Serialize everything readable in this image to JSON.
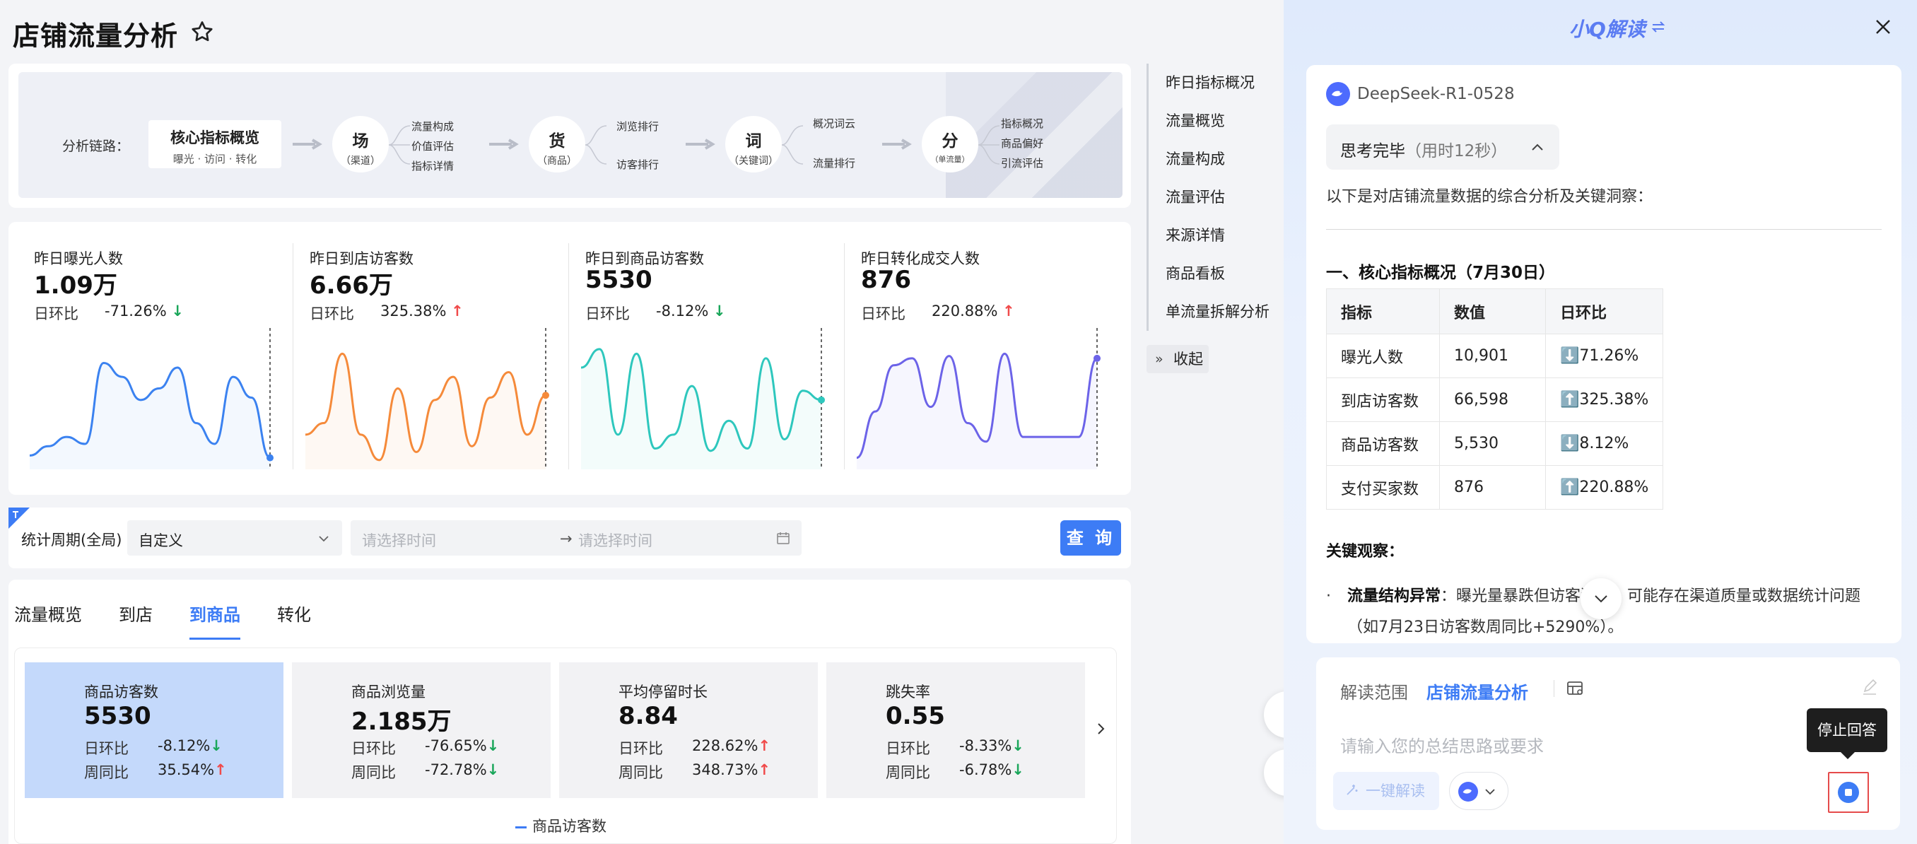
{
  "header": {
    "title": "店铺流量分析",
    "star_icon": "star-icon"
  },
  "chain": {
    "label": "分析链路：",
    "core": {
      "title": "核心指标概览",
      "sub": "曝光 · 访问 · 转化"
    },
    "nodes": [
      {
        "char": "场",
        "sub": "（渠道）",
        "items": [
          "流量构成",
          "价值评估",
          "指标详情"
        ]
      },
      {
        "char": "货",
        "sub": "（商品）",
        "items": [
          "浏览排行",
          "访客排行"
        ]
      },
      {
        "char": "词",
        "sub": "（关键词）",
        "items": [
          "概况词云",
          "流量排行"
        ]
      },
      {
        "char": "分",
        "sub": "（单流量）",
        "items": [
          "指标概况",
          "商品偏好",
          "引流评估"
        ]
      }
    ]
  },
  "kpis": [
    {
      "label": "昨日曝光人数",
      "value": "1.09万",
      "cmp_label": "日环比",
      "cmp_value": "-71.26%",
      "trend": "down",
      "color": "#3b82f0",
      "series": [
        12,
        20,
        28,
        22,
        92,
        80,
        60,
        70,
        88,
        40,
        22,
        80,
        62,
        10
      ]
    },
    {
      "label": "昨日到店访客数",
      "value": "6.66万",
      "cmp_label": "日环比",
      "cmp_value": "325.38%",
      "trend": "up",
      "color": "#f58a3a",
      "series": [
        30,
        40,
        100,
        30,
        8,
        70,
        15,
        60,
        80,
        20,
        62,
        84,
        30,
        64
      ]
    },
    {
      "label": "昨日到商品访客数",
      "value": "5530",
      "cmp_label": "日环比",
      "cmp_value": "-8.12%",
      "trend": "down",
      "color": "#2ec7bd",
      "series": [
        88,
        104,
        30,
        100,
        18,
        30,
        72,
        16,
        42,
        18,
        96,
        26,
        68,
        60
      ]
    },
    {
      "label": "昨日转化成交人数",
      "value": "876",
      "cmp_label": "日环比",
      "cmp_value": "220.88%",
      "trend": "up",
      "color": "#6c63e8",
      "series": [
        10,
        50,
        90,
        96,
        54,
        98,
        40,
        24,
        100,
        28,
        28,
        28,
        28,
        96
      ]
    }
  ],
  "filter": {
    "label": "统计周期(全局)",
    "select_value": "自定义",
    "start_placeholder": "请选择时间",
    "end_placeholder": "请选择时间",
    "arrow": "→",
    "query": "查 询"
  },
  "tabs": [
    "流量概览",
    "到店",
    "到商品",
    "转化"
  ],
  "metrics": [
    {
      "label": "商品访客数",
      "value": "5530",
      "r1l": "日环比",
      "r1v": "-8.12%",
      "r1t": "down",
      "r2l": "周同比",
      "r2v": "35.54%",
      "r2t": "up"
    },
    {
      "label": "商品浏览量",
      "value": "2.185万",
      "r1l": "日环比",
      "r1v": "-76.65%",
      "r1t": "down",
      "r2l": "周同比",
      "r2v": "-72.78%",
      "r2t": "down"
    },
    {
      "label": "平均停留时长",
      "value": "8.84",
      "r1l": "日环比",
      "r1v": "228.62%",
      "r1t": "up",
      "r2l": "周同比",
      "r2v": "348.73%",
      "r2t": "up"
    },
    {
      "label": "跳失率",
      "value": "0.55",
      "r1l": "日环比",
      "r1v": "-8.33%",
      "r1t": "down",
      "r2l": "周同比",
      "r2v": "-6.78%",
      "r2t": "down"
    }
  ],
  "legend": "商品访客数",
  "anchor_nav": [
    "昨日指标概况",
    "流量概览",
    "流量构成",
    "流量评估",
    "来源详情",
    "商品看板",
    "单流量拆解分析"
  ],
  "collapse": "收起",
  "panel": {
    "title": "小Q解读",
    "model": "DeepSeek-R1-0528",
    "think": "思考完毕",
    "think_time": "（用时12秒）",
    "intro": "以下是对店铺流量数据的综合分析及关键洞察：",
    "section": "一、核心指标概况（7月30日）",
    "table_head": [
      "指标",
      "数值",
      "日环比"
    ],
    "table_rows": [
      [
        "曝光人数",
        "10,901",
        "⬇️71.26%"
      ],
      [
        "到店访客数",
        "66,598",
        "⬆️325.38%"
      ],
      [
        "商品访客数",
        "5,530",
        "⬇️8.12%"
      ],
      [
        "支付买家数",
        "876",
        "⬆️220.88%"
      ]
    ],
    "obs_title": "关键观察：",
    "bullet_bold": "流量结构异常",
    "bullet_text": "：曝光量暴跌但访客激增，可能存在渠道质量或数据统计问题（如7月23日访客数周同比+5290%）。",
    "scope_label": "解读范围",
    "scope_value": "店铺流量分析",
    "prompt_placeholder": "请输入您的总结思路或要求",
    "one_click": "一键解读",
    "tooltip": "停止回答"
  }
}
